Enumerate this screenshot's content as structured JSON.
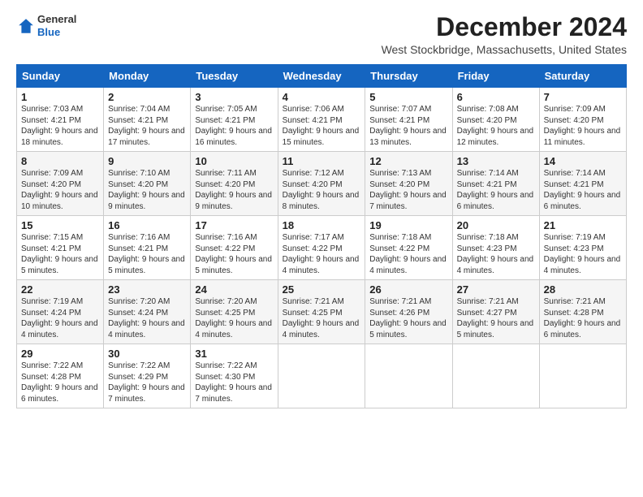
{
  "logo": {
    "general": "General",
    "blue": "Blue"
  },
  "title": "December 2024",
  "subtitle": "West Stockbridge, Massachusetts, United States",
  "days_of_week": [
    "Sunday",
    "Monday",
    "Tuesday",
    "Wednesday",
    "Thursday",
    "Friday",
    "Saturday"
  ],
  "weeks": [
    [
      {
        "day": "1",
        "sunrise": "7:03 AM",
        "sunset": "4:21 PM",
        "daylight": "9 hours and 18 minutes."
      },
      {
        "day": "2",
        "sunrise": "7:04 AM",
        "sunset": "4:21 PM",
        "daylight": "9 hours and 17 minutes."
      },
      {
        "day": "3",
        "sunrise": "7:05 AM",
        "sunset": "4:21 PM",
        "daylight": "9 hours and 16 minutes."
      },
      {
        "day": "4",
        "sunrise": "7:06 AM",
        "sunset": "4:21 PM",
        "daylight": "9 hours and 15 minutes."
      },
      {
        "day": "5",
        "sunrise": "7:07 AM",
        "sunset": "4:21 PM",
        "daylight": "9 hours and 13 minutes."
      },
      {
        "day": "6",
        "sunrise": "7:08 AM",
        "sunset": "4:20 PM",
        "daylight": "9 hours and 12 minutes."
      },
      {
        "day": "7",
        "sunrise": "7:09 AM",
        "sunset": "4:20 PM",
        "daylight": "9 hours and 11 minutes."
      }
    ],
    [
      {
        "day": "8",
        "sunrise": "7:09 AM",
        "sunset": "4:20 PM",
        "daylight": "9 hours and 10 minutes."
      },
      {
        "day": "9",
        "sunrise": "7:10 AM",
        "sunset": "4:20 PM",
        "daylight": "9 hours and 9 minutes."
      },
      {
        "day": "10",
        "sunrise": "7:11 AM",
        "sunset": "4:20 PM",
        "daylight": "9 hours and 9 minutes."
      },
      {
        "day": "11",
        "sunrise": "7:12 AM",
        "sunset": "4:20 PM",
        "daylight": "9 hours and 8 minutes."
      },
      {
        "day": "12",
        "sunrise": "7:13 AM",
        "sunset": "4:20 PM",
        "daylight": "9 hours and 7 minutes."
      },
      {
        "day": "13",
        "sunrise": "7:14 AM",
        "sunset": "4:21 PM",
        "daylight": "9 hours and 6 minutes."
      },
      {
        "day": "14",
        "sunrise": "7:14 AM",
        "sunset": "4:21 PM",
        "daylight": "9 hours and 6 minutes."
      }
    ],
    [
      {
        "day": "15",
        "sunrise": "7:15 AM",
        "sunset": "4:21 PM",
        "daylight": "9 hours and 5 minutes."
      },
      {
        "day": "16",
        "sunrise": "7:16 AM",
        "sunset": "4:21 PM",
        "daylight": "9 hours and 5 minutes."
      },
      {
        "day": "17",
        "sunrise": "7:16 AM",
        "sunset": "4:22 PM",
        "daylight": "9 hours and 5 minutes."
      },
      {
        "day": "18",
        "sunrise": "7:17 AM",
        "sunset": "4:22 PM",
        "daylight": "9 hours and 4 minutes."
      },
      {
        "day": "19",
        "sunrise": "7:18 AM",
        "sunset": "4:22 PM",
        "daylight": "9 hours and 4 minutes."
      },
      {
        "day": "20",
        "sunrise": "7:18 AM",
        "sunset": "4:23 PM",
        "daylight": "9 hours and 4 minutes."
      },
      {
        "day": "21",
        "sunrise": "7:19 AM",
        "sunset": "4:23 PM",
        "daylight": "9 hours and 4 minutes."
      }
    ],
    [
      {
        "day": "22",
        "sunrise": "7:19 AM",
        "sunset": "4:24 PM",
        "daylight": "9 hours and 4 minutes."
      },
      {
        "day": "23",
        "sunrise": "7:20 AM",
        "sunset": "4:24 PM",
        "daylight": "9 hours and 4 minutes."
      },
      {
        "day": "24",
        "sunrise": "7:20 AM",
        "sunset": "4:25 PM",
        "daylight": "9 hours and 4 minutes."
      },
      {
        "day": "25",
        "sunrise": "7:21 AM",
        "sunset": "4:25 PM",
        "daylight": "9 hours and 4 minutes."
      },
      {
        "day": "26",
        "sunrise": "7:21 AM",
        "sunset": "4:26 PM",
        "daylight": "9 hours and 5 minutes."
      },
      {
        "day": "27",
        "sunrise": "7:21 AM",
        "sunset": "4:27 PM",
        "daylight": "9 hours and 5 minutes."
      },
      {
        "day": "28",
        "sunrise": "7:21 AM",
        "sunset": "4:28 PM",
        "daylight": "9 hours and 6 minutes."
      }
    ],
    [
      {
        "day": "29",
        "sunrise": "7:22 AM",
        "sunset": "4:28 PM",
        "daylight": "9 hours and 6 minutes."
      },
      {
        "day": "30",
        "sunrise": "7:22 AM",
        "sunset": "4:29 PM",
        "daylight": "9 hours and 7 minutes."
      },
      {
        "day": "31",
        "sunrise": "7:22 AM",
        "sunset": "4:30 PM",
        "daylight": "9 hours and 7 minutes."
      },
      null,
      null,
      null,
      null
    ]
  ]
}
